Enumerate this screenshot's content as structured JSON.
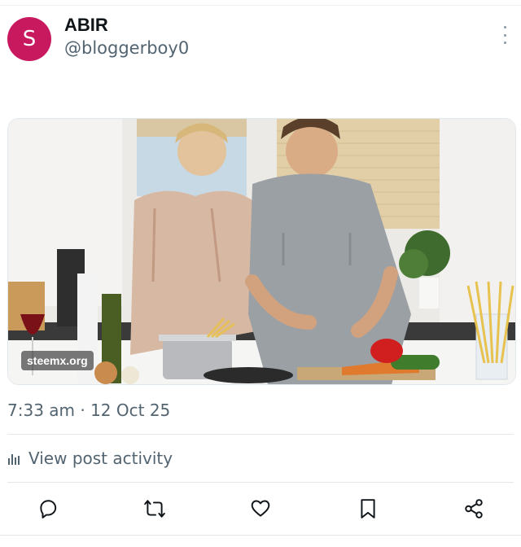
{
  "author": {
    "avatar_letter": "S",
    "display_name": "ABIR",
    "handle": "@bloggerboy0",
    "avatar_color": "#c8195f"
  },
  "post": {
    "image_watermark": "steemx.org",
    "timestamp": "7:33 am · 12 Oct 25",
    "activity_label": "View post activity"
  },
  "actions": [
    {
      "icon": "reply-icon"
    },
    {
      "icon": "repost-icon"
    },
    {
      "icon": "like-icon"
    },
    {
      "icon": "bookmark-icon"
    },
    {
      "icon": "share-icon"
    }
  ],
  "colors": {
    "secondary_text": "#536471",
    "divider": "#e3e8ea"
  }
}
